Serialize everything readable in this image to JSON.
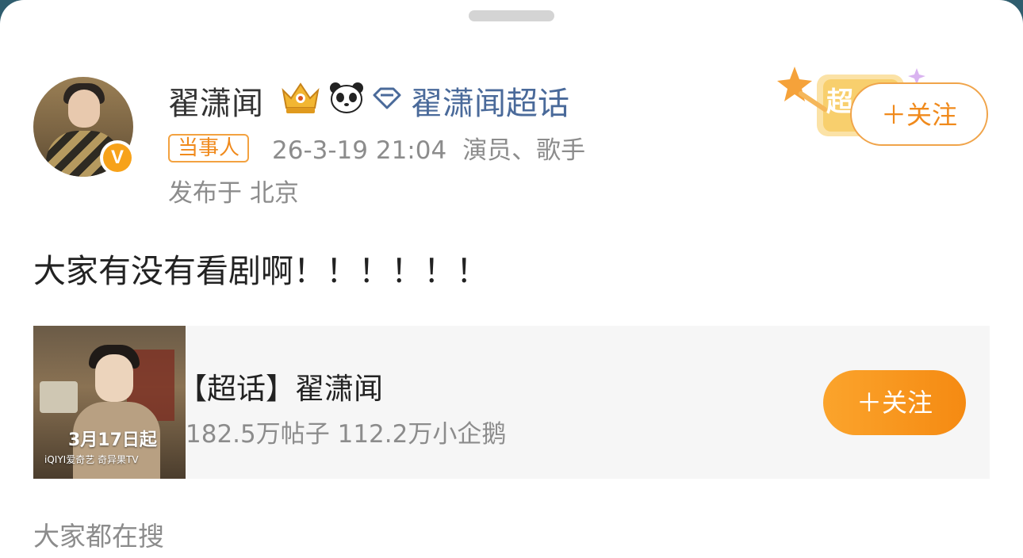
{
  "post": {
    "username": "翟潇闻",
    "topic_link": "翟潇闻超话",
    "party_tag": "当事人",
    "timestamp": "26-3-19 21:04",
    "occupation": "演员、歌手",
    "location": "发布于 北京",
    "follow_label": "＋关注",
    "deco_badge_text": "超",
    "text": "大家有没有看剧啊！！！！！！"
  },
  "supertopic_card": {
    "title": "【超话】翟潇闻",
    "stats": "182.5万帖子 112.2万小企鹅",
    "follow_label": "＋关注",
    "poster_date": "3月17日起",
    "poster_brand": "iQIYI爱奇艺  奇异果TV"
  },
  "verified_badge": "V",
  "footer": {
    "search_hint": "大家都在搜"
  },
  "colors": {
    "accent_orange": "#f58a12",
    "link_blue": "#4a6a9a",
    "meta_gray": "#8c8c8c"
  }
}
